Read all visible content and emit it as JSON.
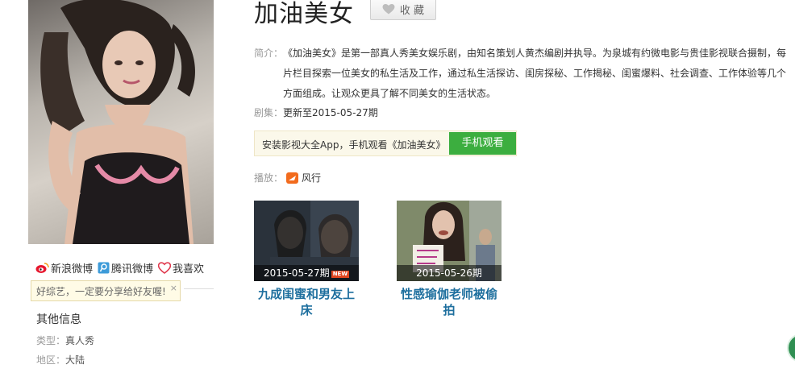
{
  "show": {
    "title": "加油美女",
    "fav_label": "收 藏",
    "intro_label": "简介：",
    "intro_text": "《加油美女》是第一部真人秀美女娱乐剧，由知名策划人黄杰编剧并执导。为泉城有约微电影与贵佳影视联合摄制，每片栏目探索一位美女的私生活及工作，通过私生活探访、闺房探秘、工作揭秘、闺蜜爆料、社会调查、工作体验等几个方面组成。让观众更具了解不同美女的生活状态。",
    "episodes_label": "剧集：",
    "episodes_value": "更新至2015-05-27期"
  },
  "app_bar": {
    "text": "安装影视大全App，手机观看《加油美女》",
    "button_label": "手机观看"
  },
  "play": {
    "label": "播放：",
    "source": "风行"
  },
  "episodes": [
    {
      "date": "2015-05-27期",
      "badge": "NEW",
      "title": "九成闺蜜和男友上床"
    },
    {
      "date": "2015-05-26期",
      "badge": "",
      "title": "性感瑜伽老师被偷拍"
    }
  ],
  "share": {
    "weibo": "新浪微博",
    "tencent": "腾讯微博",
    "like": "我喜欢",
    "tip": "好综艺，一定要分享给好友喔!",
    "tip_close": "×"
  },
  "other_info": {
    "title": "其他信息",
    "type_label": "类型：",
    "type_value": "真人秀",
    "region_label": "地区：",
    "region_value": "大陆"
  },
  "colors": {
    "app_button": "#3cae3f",
    "episode_title": "#1e6f9e",
    "new_badge": "#e0461f"
  },
  "icons": [
    "weibo-icon",
    "tencent-weibo-icon",
    "heart-icon",
    "funshion-icon"
  ]
}
